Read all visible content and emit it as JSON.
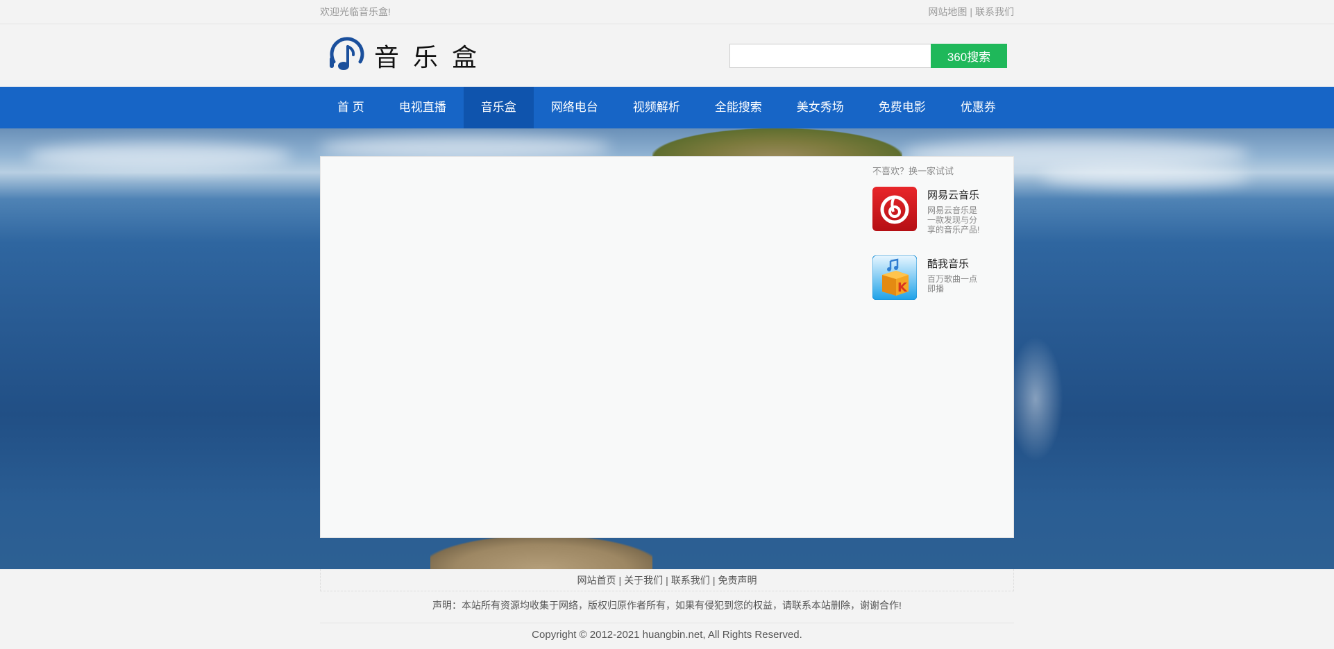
{
  "topbar": {
    "welcome": "欢迎光临音乐盒!",
    "links": [
      "网站地图",
      "联系我们"
    ],
    "separator": "|"
  },
  "header": {
    "logo_text": "音乐盒",
    "logo_icon": "headphone-note-icon",
    "search_placeholder": "",
    "search_button": "360搜索"
  },
  "nav": {
    "items": [
      "首 页",
      "电视直播",
      "音乐盒",
      "网络电台",
      "视频解析",
      "全能搜索",
      "美女秀场",
      "免费电影",
      "优惠券"
    ],
    "active_index": 2
  },
  "sidebar": {
    "hint": "不喜欢？换一家试试",
    "apps": [
      {
        "name": "网易云音乐",
        "desc": "网易云音乐是一款发现与分享的音乐产品!",
        "icon": "netease-music-icon"
      },
      {
        "name": "酷我音乐",
        "desc": "百万歌曲一点即播",
        "icon": "kuwo-music-icon"
      }
    ]
  },
  "footer": {
    "links": [
      "网站首页",
      "关于我们",
      "联系我们",
      "免责声明"
    ],
    "separator": "|",
    "notice": "声明：本站所有资源均收集于网络，版权归原作者所有，如果有侵犯到您的权益，请联系本站删除，谢谢合作!",
    "copyright": "Copyright © 2012-2021 huangbin.net, All Rights Reserved."
  },
  "colors": {
    "nav_bg": "#1765c6",
    "nav_active": "#0f54ad",
    "search_button": "#1fb85a",
    "logo_blue": "#1a4f9c"
  }
}
